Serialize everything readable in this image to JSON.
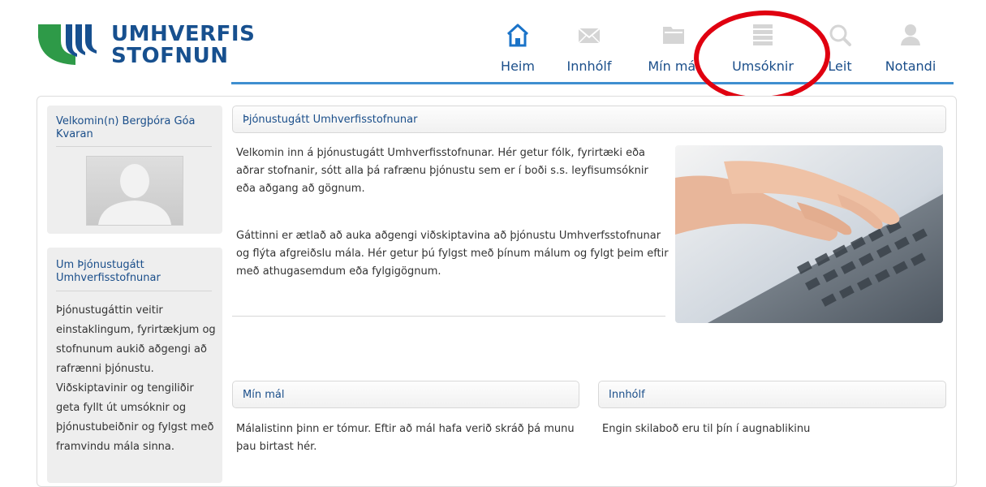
{
  "logo": {
    "line1": "UMHVERFIS",
    "line2": "STOFNUN"
  },
  "nav": {
    "items": [
      {
        "label": "Heim",
        "icon": "home-icon"
      },
      {
        "label": "Innhólf",
        "icon": "envelope-icon"
      },
      {
        "label": "Mín mál",
        "icon": "folder-icon"
      },
      {
        "label": "Umsóknir",
        "icon": "list-icon"
      },
      {
        "label": "Leit",
        "icon": "search-icon"
      },
      {
        "label": "Notandi",
        "icon": "user-icon"
      }
    ]
  },
  "sidebar": {
    "welcome": "Velkomin(n) Bergþóra Góa Kvaran",
    "about_title": "Um Þjónustugátt Umhverfisstofnunar",
    "about_text": "Þjónustugáttin veitir einstaklingum, fyrirtækjum og stofnunum aukið aðgengi að rafrænni þjónustu. Viðskiptavinir og tengiliðir geta fyllt út umsóknir og þjónustubeiðnir og fylgst með framvindu mála sinna."
  },
  "main": {
    "title": "Þjónustugátt Umhverfisstofnunar",
    "intro": "Velkomin inn á þjónustugátt Umhverfisstofnunar. Hér getur fólk, fyrirtæki eða aðrar stofnanir, sótt alla þá rafrænu þjónustu sem er í boði s.s. leyfisumsóknir eða aðgang að gögnum.",
    "intro2": "Gáttinni er ætlað að auka aðgengi viðskiptavina að þjónustu Umhverfsstofnunar og flýta afgreiðslu mála. Hér getur þú fylgst með þínum málum og fylgt þeim eftir með athugasemdum eða fylgigögnum."
  },
  "cases": {
    "title": "Mín mál",
    "text": "Málalistinn þinn er tómur. Eftir að mál hafa verið skráð þá munu þau birtast hér."
  },
  "inbox": {
    "title": "Innhólf",
    "text": "Engin skilaboð eru til þín í augnablikinu"
  },
  "colors": {
    "brand_blue": "#17508f",
    "brand_green": "#3aa84a",
    "accent_line": "#3f8fd0",
    "highlight": "#e00010"
  }
}
